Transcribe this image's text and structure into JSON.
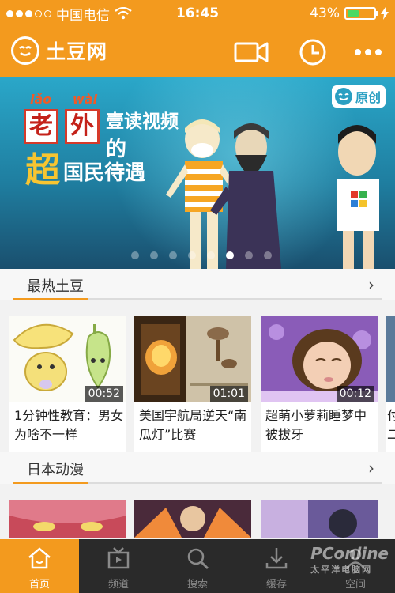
{
  "status_bar": {
    "carrier": "中国电信",
    "time": "16:45",
    "battery": "43%",
    "battery_level": 0.43,
    "signal_bars": 3
  },
  "header": {
    "app_name": "土豆网",
    "icons": [
      "video-camera-icon",
      "history-clock-icon",
      "more-icon"
    ]
  },
  "banner": {
    "pinyin_1": "lǎo",
    "pinyin_2": "wài",
    "char_1": "老",
    "char_2": "外",
    "char_3": "超",
    "line_1": "壹读视频",
    "line_2": "的",
    "line_3": "国民待遇",
    "badge": "原创",
    "slide_count": 8,
    "active_slide": 6
  },
  "sections": [
    {
      "title": "最热土豆",
      "more": "›",
      "videos": [
        {
          "title": "1分钟性教育：男女为啥不一样",
          "duration": "00:52"
        },
        {
          "title": "美国宇航局逆天“南瓜灯”比赛",
          "duration": "01:01"
        },
        {
          "title": "超萌小萝莉睡梦中被拔牙",
          "duration": "00:12"
        },
        {
          "title": "付二",
          "duration": ""
        }
      ]
    },
    {
      "title": "日本动漫",
      "more": "›"
    }
  ],
  "bottom_nav": [
    {
      "label": "首页",
      "icon": "home-icon",
      "active": true
    },
    {
      "label": "频道",
      "icon": "tv-icon",
      "active": false
    },
    {
      "label": "搜索",
      "icon": "search-icon",
      "active": false
    },
    {
      "label": "缓存",
      "icon": "download-icon",
      "active": false
    },
    {
      "label": "空间",
      "icon": "user-icon",
      "active": false
    }
  ],
  "watermark": {
    "brand": "PConline",
    "sub": "太平洋电脑网"
  },
  "colors": {
    "accent": "#f39a1e",
    "nav_bg": "#2a2a2a"
  }
}
